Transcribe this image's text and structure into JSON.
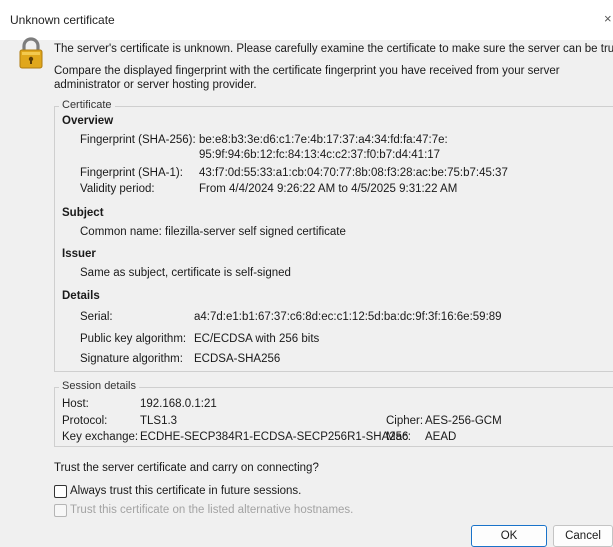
{
  "window": {
    "title": "Unknown certificate",
    "close_glyph": "×"
  },
  "intro": {
    "line1": "The server's certificate is unknown. Please carefully examine the certificate to make sure the server can be truste",
    "line2": "Compare the displayed fingerprint with the certificate fingerprint you have received from your server",
    "line3": "administrator or server hosting provider."
  },
  "certificate": {
    "legend": "Certificate",
    "overview": {
      "heading": "Overview",
      "sha256_label": "Fingerprint (SHA-256):",
      "sha256_line1": "be:e8:b3:3e:d6:c1:7e:4b:17:37:a4:34:fd:fa:47:7e:",
      "sha256_line2": "95:9f:94:6b:12:fc:84:13:4c:c2:37:f0:b7:d4:41:17",
      "sha1_label": "Fingerprint (SHA-1):",
      "sha1_value": "43:f7:0d:55:33:a1:cb:04:70:77:8b:08:f3:28:ac:be:75:b7:45:37",
      "validity_label": "Validity period:",
      "validity_value": "From 4/4/2024 9:26:22 AM to 4/5/2025 9:31:22 AM"
    },
    "subject": {
      "heading": "Subject",
      "common_name": "Common name: filezilla-server self signed certificate"
    },
    "issuer": {
      "heading": "Issuer",
      "text": "Same as subject, certificate is self-signed"
    },
    "details": {
      "heading": "Details",
      "serial_label": "Serial:",
      "serial_value": "a4:7d:e1:b1:67:37:c6:8d:ec:c1:12:5d:ba:dc:9f:3f:16:6e:59:89",
      "pubkey_label": "Public key algorithm:",
      "pubkey_value": "EC/ECDSA with 256 bits",
      "sigalg_label": "Signature algorithm:",
      "sigalg_value": "ECDSA-SHA256"
    }
  },
  "session": {
    "legend": "Session details",
    "host_label": "Host:",
    "host_value": "192.168.0.1:21",
    "protocol_label": "Protocol:",
    "protocol_value": "TLS1.3",
    "cipher_label": "Cipher:",
    "cipher_value": "AES-256-GCM",
    "kex_label": "Key exchange:",
    "kex_value": "ECDHE-SECP384R1-ECDSA-SECP256R1-SHA256",
    "mac_label": "Mac:",
    "mac_value": "AEAD"
  },
  "trust": {
    "question": "Trust the server certificate and carry on connecting?",
    "always_label": "Always trust this certificate in future sessions.",
    "always_checked": false,
    "alt_label": "Trust this certificate on the listed alternative hostnames.",
    "alt_checked": false,
    "alt_enabled": false
  },
  "buttons": {
    "ok": "OK",
    "cancel": "Cancel"
  },
  "colors": {
    "accent": "#1a73c9",
    "lock_body": "#e0a71c",
    "lock_shackle": "#7d7d7d"
  }
}
